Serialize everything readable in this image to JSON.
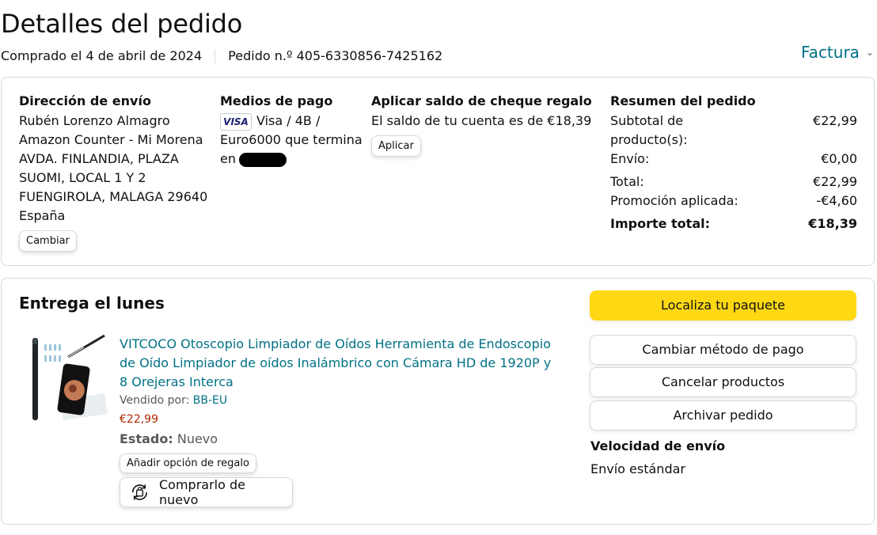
{
  "header": {
    "title": "Detalles del pedido",
    "purchased": "Comprado el 4 de abril de 2024",
    "order_number": "Pedido n.º 405-6330856-7425162",
    "invoice_label": "Factura"
  },
  "shipping": {
    "heading": "Dirección de envío",
    "lines": [
      "Rubén Lorenzo Almagro",
      "Amazon Counter - Mi Morena",
      "AVDA. FINLANDIA, PLAZA",
      "SUOMI, LOCAL 1 Y 2",
      "FUENGIROLA, MALAGA 29640",
      "España"
    ],
    "change_label": "Cambiar"
  },
  "payment": {
    "heading": "Medios de pago",
    "card_brand": "VISA",
    "line1": "Visa / 4B /",
    "line2": "Euro6000 que termina",
    "line3": "en"
  },
  "gift": {
    "heading": "Aplicar saldo de cheque regalo",
    "balance_text": "El saldo de tu cuenta es de €18,39",
    "apply_label": "Aplicar"
  },
  "summary": {
    "heading": "Resumen del pedido",
    "rows": [
      {
        "label": "Subtotal de",
        "label2": "producto(s):",
        "value": "€22,99"
      },
      {
        "label": "Envío:",
        "value": "€0,00"
      },
      {
        "label": "Total:",
        "value": "€22,99"
      },
      {
        "label": "Promoción aplicada:",
        "value": "-€4,60"
      },
      {
        "label": "Importe total:",
        "value": "€18,39"
      }
    ]
  },
  "delivery": {
    "heading": "Entrega el lunes",
    "product_title": "VITCOCO Otoscopio Limpiador de Oídos Herramienta de Endoscopio de Oído Limpiador de oídos Inalámbrico con Cámara HD de 1920P y 8 Orejeras Interca",
    "sold_by_label": "Vendido por:",
    "seller": "BB-EU",
    "price": "€22,99",
    "status_label": "Estado:",
    "status_value": "Nuevo",
    "gift_option_label": "Añadir opción de regalo",
    "buy_again_label": "Comprarlo de nuevo"
  },
  "actions": {
    "track": "Localiza tu paquete",
    "change_payment": "Cambiar método de pago",
    "cancel": "Cancelar productos",
    "archive": "Archivar pedido"
  },
  "shipping_speed": {
    "heading": "Velocidad de envío",
    "value": "Envío estándar"
  },
  "colors": {
    "link": "#007185",
    "price": "#b12704",
    "primary_button": "#ffd814",
    "border": "#d5d9d9"
  }
}
